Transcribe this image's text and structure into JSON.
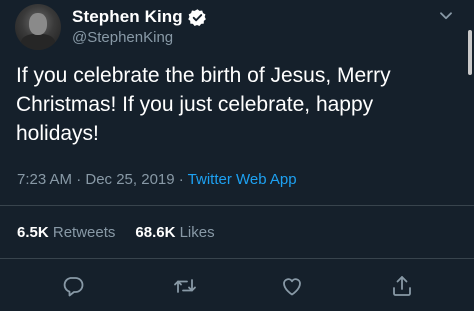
{
  "author": {
    "display_name": "Stephen King",
    "handle": "@StephenKing"
  },
  "tweet": {
    "text": "If you celebrate the birth of Jesus, Merry Christmas! If you just celebrate, happy holidays!",
    "timestamp": "7:23 AM · Dec 25, 2019",
    "separator": " · ",
    "source": "Twitter Web App"
  },
  "stats": {
    "retweets_count": "6.5K",
    "retweets_label": "Retweets",
    "likes_count": "68.6K",
    "likes_label": "Likes"
  },
  "icons": {
    "verified": "verified-badge-icon",
    "caret": "chevron-down-icon",
    "reply": "reply-icon",
    "retweet": "retweet-icon",
    "like": "heart-icon",
    "share": "share-icon"
  },
  "colors": {
    "background": "#15202b",
    "secondary_text": "#8899a6",
    "accent": "#1da1f2",
    "divider": "#38444d"
  }
}
